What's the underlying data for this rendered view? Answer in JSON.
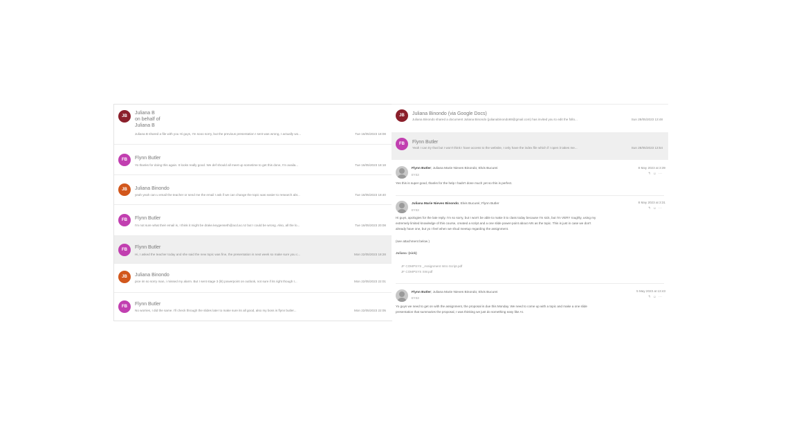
{
  "colors": {
    "maroon": "#8b1f2b",
    "magenta": "#c13fb0",
    "orange": "#d2571c",
    "selected_bg": "#efefef"
  },
  "list": [
    {
      "initials": "JB",
      "sender_lines": [
        "Juliana B",
        "on behalf of",
        "Juliana B"
      ],
      "preview": "Juliana B shared a file with you Hi guys, I'm sooo sorry, but the previous presentation I sent was wrong, I actually wo...",
      "date": "Tue 16/05/2023 18:08",
      "color": "maroon"
    },
    {
      "initials": "FB",
      "sender_lines": [
        "Flynn Butler"
      ],
      "preview": "Yo thanks for doing this again. It looks really good. We def should all meet up sometime to get this done, I'm availa...",
      "date": "Tue 16/05/2023 18:18",
      "color": "magenta"
    },
    {
      "initials": "JB",
      "sender_lines": [
        "Juliana Binondo"
      ],
      "preview": "yeah yeah can u email the teacher or send me the email I ask if we can change the topic was easier to research abt...",
      "date": "Tue 16/05/2023 18:40",
      "color": "orange"
    },
    {
      "initials": "FB",
      "sender_lines": [
        "Flynn Butler"
      ],
      "preview": "I'm not sure what their email is, I think it might be drake.keygenseth@acd.ac.nz but I could be wrong. Also, all the lo...",
      "date": "Tue 16/05/2023 20:08",
      "color": "magenta"
    },
    {
      "initials": "FB",
      "sender_lines": [
        "Flynn Butler"
      ],
      "preview": "Hi, I asked the teacher today and she said the new topic was fine, the presentation is next week so make sure you c...",
      "date": "Mon 22/05/2023 18:28",
      "color": "magenta",
      "selected": true
    },
    {
      "initials": "JB",
      "sender_lines": [
        "Juliana Binondo"
      ],
      "preview": "pice im so sorry man, i missed my alarm. But I sent stage 3 (lit) powerpoint on outlook, not sure if its right though I...",
      "date": "Mon 22/05/2023 22:01",
      "color": "orange"
    },
    {
      "initials": "FB",
      "sender_lines": [
        "Flynn Butler"
      ],
      "preview": "No worries, I did the same. I'll check through the slides later to make sure its all good, also my boss is flynn butler...",
      "date": "Mon 22/05/2023 22:05",
      "color": "magenta"
    }
  ],
  "right_list": [
    {
      "initials": "JB",
      "sender": "Juliana Binondo (via Google Docs)",
      "preview": "Juliana Binondo shared a document Juliana Binondo (julianabinondo69@gmail.com) has invited you to edit the follo...",
      "date": "Sun 28/05/2023 13:48",
      "color": "maroon"
    },
    {
      "initials": "FB",
      "sender": "Flynn Butler",
      "preview": "Yeah I can try that but I won't think I have access to the website, I only have the index file which if I open it takes me...",
      "date": "Sun 28/05/2023 13:54",
      "color": "magenta",
      "selected": true
    }
  ],
  "thread": [
    {
      "from_bold": "Flynn Butler",
      "from_rest": "; Juliana Marie Nieves Binondo; Elvis Bucurei",
      "sub": "EYS3",
      "date": "8 May 2023 at 3:39",
      "body": [
        "Yes this is super good, thanks for the help I hadn't done much yet so this is perfect."
      ]
    },
    {
      "from_bold": "Juliana Marie Nieves Binondo",
      "from_rest": "; Elvis Bucurei; Flynn Butler",
      "sub": "EYS3",
      "date": "8 May 2023 at 3:31",
      "body": [
        "Hi guys, apologies for the late reply. I'm so sorry, but I won't be able to make it to class today because I'm sick, but I'm VERY roughly, using my",
        "extremely limited knowledge of this course, created a script and a one slide power-point about AIN as the topic. This is just in case we don't",
        "already have one, but yo I feel when we shud meetup regarding the assignment."
      ],
      "extra": [
        "(see attachment below )",
        "Juliana :(sick)"
      ],
      "attachments": [
        "JF COMPSYS _Assignment Intro Script.pdf",
        "JF COMPSYS SW.pdf"
      ]
    },
    {
      "from_bold": "Flynn Butler",
      "from_rest": "; Juliana Marie Nieves Binondo; Elvis Bucurei",
      "sub": "EYS3",
      "date": "5 May 2023 at 13:43",
      "body": [
        "Yo guys we need to get on with the assignment, the proposal is due this Monday. We need to come up with a topic and make a one slide",
        "presentation that summaries the proposal, I was thinking we just do something easy like AI."
      ]
    }
  ],
  "icons": [
    "reply-icon",
    "reply-all-icon",
    "more-icon"
  ]
}
